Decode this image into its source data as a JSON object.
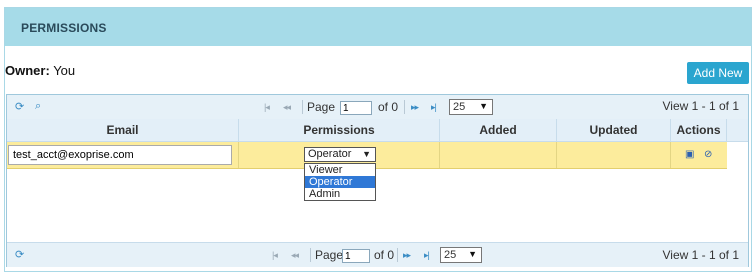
{
  "panel": {
    "title": "PERMISSIONS"
  },
  "owner": {
    "label": "Owner:",
    "value": "You"
  },
  "toolbar": {
    "add_new_label": "Add New"
  },
  "pager": {
    "page_label": "Page",
    "page_value": "1",
    "of_label": "of 0",
    "rows_per_page": "25",
    "view_text": "View 1 - 1 of 1"
  },
  "columns": [
    "Email",
    "Permissions",
    "Added",
    "Updated",
    "Actions"
  ],
  "row": {
    "email": "test_acct@exoprise.com",
    "permission": "Operator"
  },
  "permission_options": [
    "Viewer",
    "Operator",
    "Admin"
  ],
  "icons": {
    "refresh": "refresh-icon",
    "search": "search-icon",
    "save": "save-icon",
    "cancel": "cancel-icon"
  },
  "colors": {
    "header_bg": "#a6dbe8",
    "button_bg": "#2aa5cf",
    "row_highlight": "#fcec9c",
    "selected_option": "#2f78d6"
  }
}
